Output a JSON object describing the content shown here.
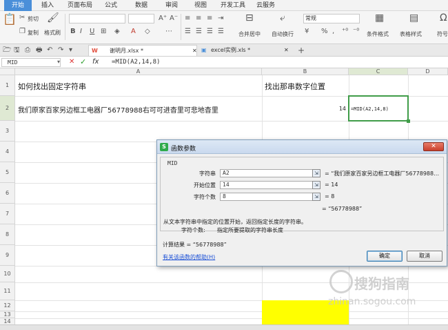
{
  "menu": [
    "开始",
    "插入",
    "页面布局",
    "公式",
    "数据",
    "审阅",
    "视图",
    "开发工具",
    "云服务"
  ],
  "ribbon": {
    "cut": "剪切",
    "copy": "复制",
    "format_painter": "格式刷",
    "merge_center": "合并居中",
    "auto_wrap": "自动换行",
    "number_format": "常规",
    "cond_format": "条件格式",
    "table_style": "表格样式",
    "symbol": "符号",
    "bold": "B",
    "italic": "I",
    "underline": "U",
    "percent": "%"
  },
  "tabs": [
    {
      "label": "谢明月.xlsx *",
      "icon_color": "#e14d3c"
    },
    {
      "label": "excel实例.xls *",
      "icon_color": "#4a8fd9"
    }
  ],
  "formula_bar": {
    "name_box": "MID",
    "cancel": "✕",
    "confirm": "✓",
    "fx": "fx",
    "formula": "=MID(A2,14,8)"
  },
  "columns": [
    "A",
    "B",
    "C",
    "D"
  ],
  "rows": [
    "1",
    "2",
    "3",
    "4",
    "5",
    "6",
    "7",
    "8",
    "9",
    "10",
    "11",
    "12",
    "13",
    "14"
  ],
  "cells": {
    "a1": "如何找出固定字符串",
    "b1": "找出那串数字位置",
    "a2": "我们原家百家另边框工电器厂56778988右可可进杳里可悲地杳里",
    "b2": "14",
    "c2": "=MID(A2,14,8)"
  },
  "highlight_color": "#ffff00",
  "dialog": {
    "title": "函数参数",
    "function": "MID",
    "args": [
      {
        "label": "字符串",
        "value": "A2",
        "result": "= “我们原家百家另边框工电器厂56778988…"
      },
      {
        "label": "开始位置",
        "value": "14",
        "result": "= 14"
      },
      {
        "label": "字符个数",
        "value": "8",
        "result": "= 8"
      }
    ],
    "value_result": "= “56778988”",
    "description": "从文本字符串中指定的位置开始，返回指定长度的字符串。",
    "arg_help_label": "字符个数:",
    "arg_help_text": "指定所要提取的字符串长度",
    "calc_result": "计算结果 = “56778988”",
    "help_link": "有关该函数的帮助(H)",
    "ok": "确定",
    "cancel": "取消"
  },
  "watermark": {
    "brand": "搜狗指南",
    "url": "zhinan.sogou.com"
  }
}
